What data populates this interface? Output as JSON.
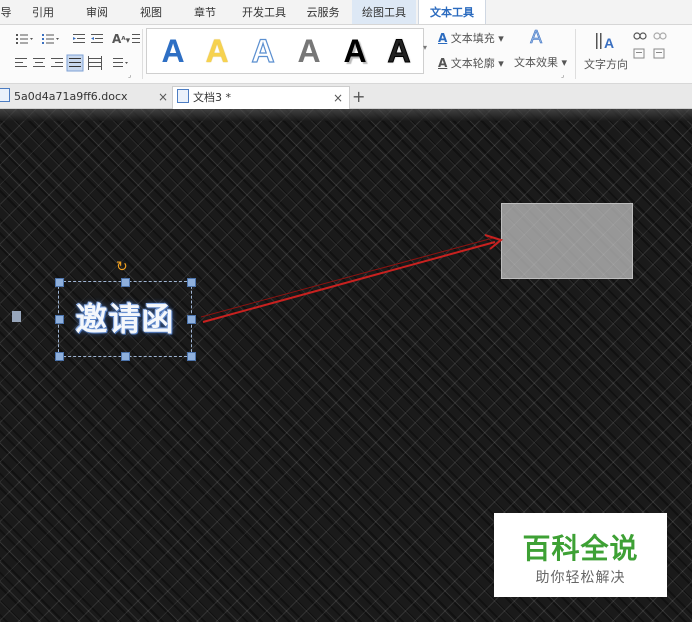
{
  "menu": {
    "tabs": [
      {
        "label": "导",
        "id": "dao"
      },
      {
        "label": "引用",
        "id": "reference"
      },
      {
        "label": "审阅",
        "id": "review"
      },
      {
        "label": "视图",
        "id": "view"
      },
      {
        "label": "章节",
        "id": "chapter"
      },
      {
        "label": "开发工具",
        "id": "devtools"
      },
      {
        "label": "云服务",
        "id": "cloud"
      },
      {
        "label": "绘图工具",
        "id": "drawing-tools"
      },
      {
        "label": "文本工具",
        "id": "text-tools"
      }
    ],
    "active_tab": "文本工具",
    "colors": {
      "active_text": "#2b6bbf",
      "active_draw_bg": "#dde8f5"
    }
  },
  "ribbon": {
    "style_letter": "A",
    "text_fill_label": "文本填充",
    "text_outline_label": "文本轮廓",
    "text_effect_label": "文本效果",
    "text_direction_label": "文字方向",
    "font_size_symbol": "A",
    "icons": [
      "bullet-list-icon",
      "numbered-list-icon",
      "decrease-indent-icon",
      "increase-indent-icon",
      "align-left-icon",
      "align-center-icon",
      "align-right-icon",
      "justify-icon",
      "distributed-icon",
      "line-spacing-icon"
    ]
  },
  "doc_tabs": [
    {
      "label": "5a0d4a71a9ff6.docx",
      "active": false
    },
    {
      "label": "文档3 *",
      "active": true
    }
  ],
  "add_tab_symbol": "+",
  "close_symbol": "×",
  "canvas": {
    "textbox_text": "邀请函",
    "arrow_color": "#c8211f",
    "background_color": "#1a1a1a"
  },
  "watermark": {
    "title": "百科全说",
    "subtitle": "助你轻松解决",
    "title_color": "#3ea135"
  }
}
